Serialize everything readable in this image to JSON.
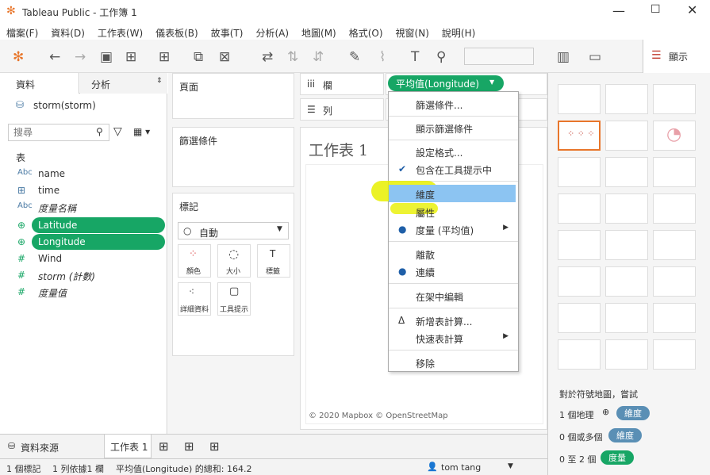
{
  "window": {
    "title": "Tableau Public - 工作簿 1"
  },
  "menu_bar": [
    "檔案(F)",
    "資料(D)",
    "工作表(W)",
    "儀表板(B)",
    "故事(T)",
    "分析(A)",
    "地圖(M)",
    "格式(O)",
    "視窗(N)",
    "說明(H)"
  ],
  "toolbar": {
    "showme_label": "顯示"
  },
  "left_panel": {
    "tab_data": "資料",
    "tab_analytics": "分析",
    "datasource": "storm(storm)",
    "search_placeholder": "搜尋",
    "section_label": "表",
    "fields": [
      {
        "icon": "Abc",
        "label": "name"
      },
      {
        "icon": "cal",
        "label": "time"
      },
      {
        "icon": "Abc",
        "label": "度量名稱"
      },
      {
        "icon": "globe",
        "label": "Latitude"
      },
      {
        "icon": "globe",
        "label": "Longitude"
      },
      {
        "icon": "#",
        "label": "Wind"
      },
      {
        "icon": "#",
        "label": "storm (計數)"
      },
      {
        "icon": "#",
        "label": "度量值"
      }
    ]
  },
  "cards": {
    "pages": "頁面",
    "filters": "篩選條件",
    "marks": "標記",
    "marks_type": "自動",
    "marks_buttons": [
      "顏色",
      "大小",
      "標籤",
      "詳細資料",
      "工具提示"
    ]
  },
  "shelves": {
    "columns_label": "欄",
    "rows_label": "列",
    "column_pill": "平均值(Longitude)"
  },
  "sheet": {
    "title": "工作表 1",
    "attribution": "© 2020 Mapbox © OpenStreetMap"
  },
  "context_menu": {
    "items": [
      "篩選條件...",
      "顯示篩選條件",
      "設定格式...",
      "包含在工具提示中",
      "維度",
      "屬性",
      "度量 (平均值)",
      "離散",
      "連續",
      "在架中編輯",
      "新增表計算...",
      "快速表計算",
      "移除"
    ]
  },
  "show_me": {
    "hint": "對於符號地圖，嘗試",
    "rows": [
      {
        "text": "1 個地理",
        "chip": "維度"
      },
      {
        "text": "0 個或多個",
        "chip": "維度"
      },
      {
        "text": "0 至 2 個",
        "chip": "度量"
      }
    ]
  },
  "bottom_tabs": {
    "datasource": "資料來源",
    "sheet": "工作表 1"
  },
  "status_bar": {
    "marks": "1 個標記",
    "rows_cols": "1 列依據1 欄",
    "sum": "平均值(Longitude) 的總和: 164.2",
    "user": "tom tang"
  }
}
